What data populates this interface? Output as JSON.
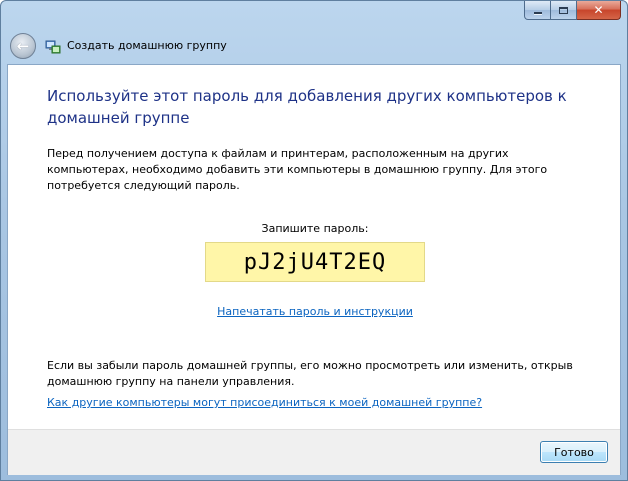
{
  "window": {
    "caption_buttons": {
      "minimize_icon": "minimize-icon",
      "maximize_icon": "maximize-icon",
      "close_icon": "close-icon",
      "close_glyph": "✕"
    }
  },
  "nav": {
    "back_icon": "back-arrow-icon",
    "back_glyph": "←",
    "title": "Создать домашнюю группу"
  },
  "content": {
    "heading": "Используйте этот пароль для добавления других компьютеров к домашней группе",
    "description": "Перед получением доступа к файлам и принтерам, расположенным на других компьютерах, необходимо добавить эти компьютеры в домашнюю группу. Для этого потребуется следующий пароль.",
    "password_label": "Запишите пароль:",
    "password_value": "pJ2jU4T2EQ",
    "print_link": "Напечатать пароль и инструкции",
    "forgot_text": "Если вы забыли пароль домашней группы, его можно просмотреть или изменить, открыв домашнюю группу на панели управления.",
    "help_link": "Как другие компьютеры могут присоединиться к моей домашней группе?"
  },
  "footer": {
    "done_label": "Готово"
  },
  "colors": {
    "heading": "#1e3287",
    "link": "#0b64c0",
    "password_bg": "#fff6a8",
    "close_button": "#c7452b"
  }
}
